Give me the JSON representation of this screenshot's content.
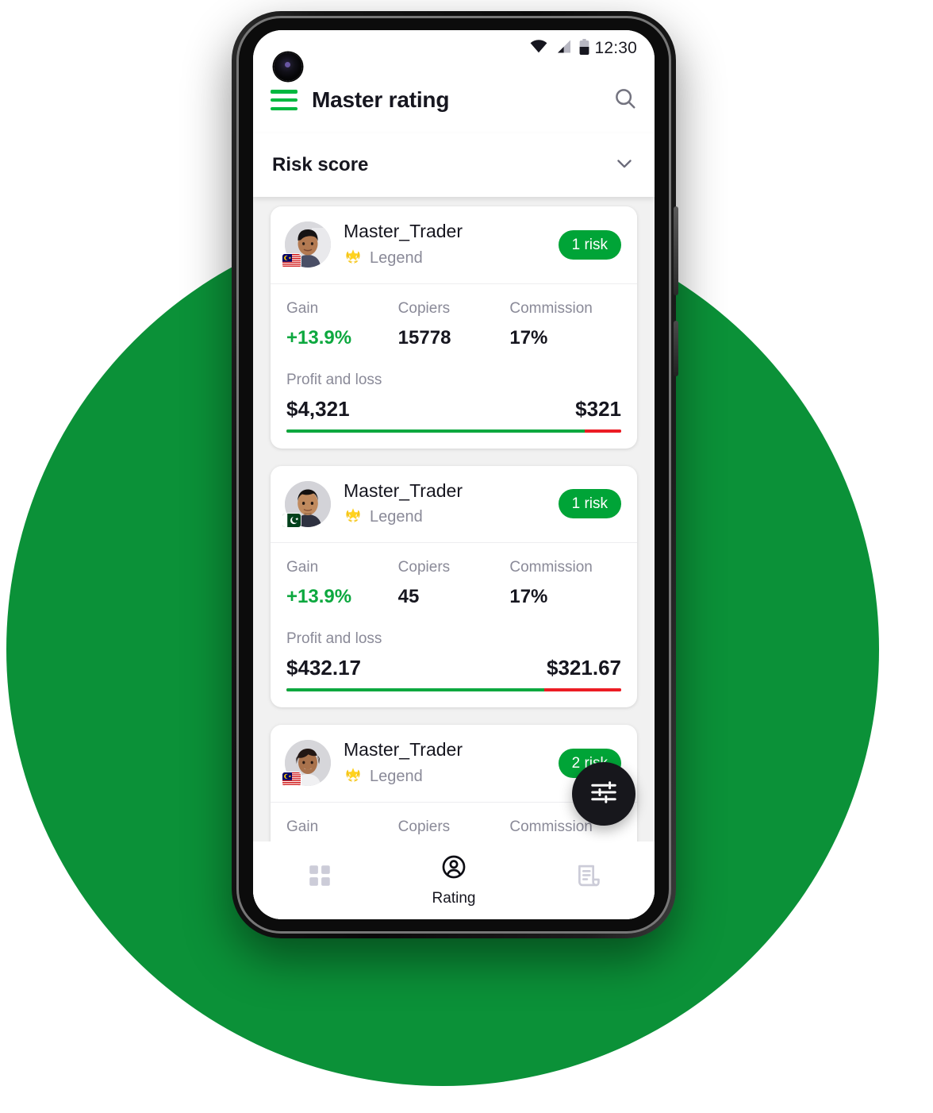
{
  "statusbar": {
    "time": "12:30",
    "icons": [
      "wifi-icon",
      "cellular-signal-icon",
      "battery-icon"
    ]
  },
  "appbar": {
    "menu_icon": "hamburger-menu-icon",
    "title": "Master rating",
    "search_icon": "search-icon",
    "menu_color": "#00B83F"
  },
  "filter": {
    "label": "Risk score",
    "chevron_icon": "chevron-down-icon"
  },
  "cards": [
    {
      "name": "Master_Trader",
      "rank": "Legend",
      "rank_icon": "laurel-star-badge-icon",
      "country": "Malaysia",
      "flag": "malaysia-flag-icon",
      "risk": "1 risk",
      "stats": [
        {
          "label": "Gain",
          "value": "+13.9%",
          "accent": "green"
        },
        {
          "label": "Copiers",
          "value": "15778",
          "accent": "dark"
        },
        {
          "label": "Commission",
          "value": "17%",
          "accent": "dark"
        }
      ],
      "pl_label": "Profit and loss",
      "profit": "$4,321",
      "loss": "$321",
      "bar_green_pct": 89,
      "bar_red_pct": 11
    },
    {
      "name": "Master_Trader",
      "rank": "Legend",
      "rank_icon": "laurel-star-badge-icon",
      "country": "Pakistan",
      "flag": "pakistan-flag-icon",
      "risk": "1 risk",
      "stats": [
        {
          "label": "Gain",
          "value": "+13.9%",
          "accent": "green"
        },
        {
          "label": "Copiers",
          "value": "45",
          "accent": "dark"
        },
        {
          "label": "Commission",
          "value": "17%",
          "accent": "dark"
        }
      ],
      "pl_label": "Profit and loss",
      "profit": "$432.17",
      "loss": "$321.67",
      "bar_green_pct": 77,
      "bar_red_pct": 23
    },
    {
      "name": "Master_Trader",
      "rank": "Legend",
      "rank_icon": "laurel-star-badge-icon",
      "country": "Malaysia",
      "flag": "malaysia-flag-icon",
      "risk": "2 risk",
      "stats": [
        {
          "label": "Gain",
          "value": "",
          "accent": "green"
        },
        {
          "label": "Copiers",
          "value": "",
          "accent": "dark"
        },
        {
          "label": "Commission",
          "value": "",
          "accent": "dark"
        }
      ],
      "pl_label": "",
      "profit": "",
      "loss": "",
      "bar_green_pct": 0,
      "bar_red_pct": 0
    }
  ],
  "fab": {
    "icon": "tune-sliders-icon"
  },
  "bottomnav": {
    "items": [
      {
        "icon": "grid-dashboard-icon",
        "label": "",
        "active": false
      },
      {
        "icon": "account-circle-icon",
        "label": "Rating",
        "active": true
      },
      {
        "icon": "document-receipt-icon",
        "label": "",
        "active": false
      }
    ]
  },
  "colors": {
    "brand_green": "#00B83F",
    "badge_green": "#00A437",
    "gain_green": "#0DA83F",
    "loss_red": "#ec1c24",
    "background_circle": "#0B9138",
    "muted_text": "#8a8a98",
    "dark_text": "#16161f"
  }
}
